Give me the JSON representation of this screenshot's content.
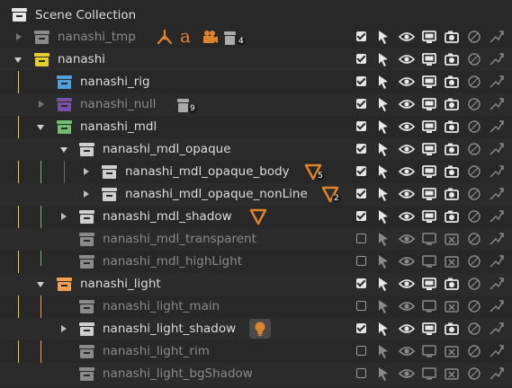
{
  "header": {
    "label": "Scene Collection"
  },
  "rows": [
    {
      "label": "nanashi_tmp",
      "color": "#8a8a8a",
      "checked": true,
      "label_dim": true,
      "extra": [
        "armature-icon",
        "text-icon",
        "camera-icon",
        "collection-count-4"
      ],
      "count": "4"
    },
    {
      "label": "nanashi",
      "color": "#e5cf2d",
      "checked": true,
      "label_dim": false
    },
    {
      "label": "nanashi_rig",
      "color": "#4ea1d8",
      "checked": true,
      "label_dim": false
    },
    {
      "label": "nanashi_null",
      "color": "#7a4fa6",
      "checked": true,
      "label_dim": true,
      "count": "9"
    },
    {
      "label": "nanashi_mdl",
      "color": "#6fbe6b",
      "checked": true,
      "label_dim": false
    },
    {
      "label": "nanashi_mdl_opaque",
      "color": "#cfcfcf",
      "checked": true,
      "label_dim": false
    },
    {
      "label": "nanashi_mdl_opaque_body",
      "color": "#cfcfcf",
      "checked": true,
      "label_dim": false,
      "count": "5"
    },
    {
      "label": "nanashi_mdl_opaque_nonLine",
      "color": "#cfcfcf",
      "checked": true,
      "label_dim": false,
      "count": "2"
    },
    {
      "label": "nanashi_mdl_shadow",
      "color": "#cfcfcf",
      "checked": true,
      "label_dim": false
    },
    {
      "label": "nanashi_mdl_transparent",
      "color": "#8a8a8a",
      "checked": false,
      "label_dim": true
    },
    {
      "label": "nanashi_mdl_highLight",
      "color": "#8a8a8a",
      "checked": false,
      "label_dim": true
    },
    {
      "label": "nanashi_light",
      "color": "#f0a050",
      "checked": true,
      "label_dim": false
    },
    {
      "label": "nanashi_light_main",
      "color": "#8a8a8a",
      "checked": false,
      "label_dim": true
    },
    {
      "label": "nanashi_light_shadow",
      "color": "#cfcfcf",
      "checked": true,
      "label_dim": false
    },
    {
      "label": "nanashi_light_rim",
      "color": "#8a8a8a",
      "checked": false,
      "label_dim": true
    },
    {
      "label": "nanashi_light_bgShadow",
      "color": "#8a8a8a",
      "checked": false,
      "label_dim": true
    }
  ],
  "colors": {
    "accent_orange": "#e0822a",
    "background": "#282828"
  }
}
